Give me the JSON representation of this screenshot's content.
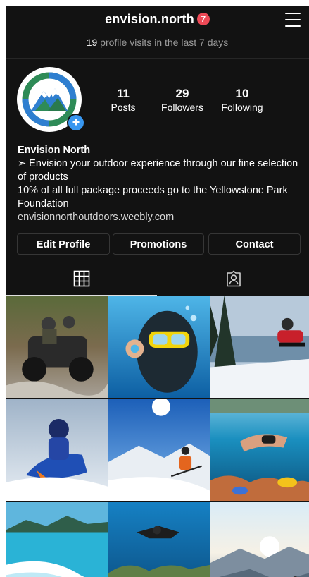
{
  "header": {
    "username": "envision.north",
    "notification_count": "7",
    "visits_count": "19",
    "visits_text": " profile visits in the last 7 days"
  },
  "profile": {
    "stats": {
      "posts": {
        "value": "11",
        "label": "Posts"
      },
      "followers": {
        "value": "29",
        "label": "Followers"
      },
      "following": {
        "value": "10",
        "label": "Following"
      }
    },
    "name": "Envision North",
    "bio_line1": "➣ Envision your outdoor experience through our fine selection of products",
    "bio_line2": "10% of all full package proceeds go to the Yellowstone Park Foundation",
    "website": "envisionnorthoutdoors.weebly.com",
    "add_story_glyph": "+"
  },
  "actions": {
    "edit_profile": "Edit Profile",
    "promotions": "Promotions",
    "contact": "Contact"
  },
  "tabs": [
    {
      "icon": "grid-icon",
      "active": true
    },
    {
      "icon": "tagged-person-icon",
      "active": false
    }
  ],
  "icons": {
    "menu": "hamburger-menu-icon",
    "logo": "mountain-logo-icon"
  },
  "colors": {
    "background": "#121212",
    "badge": "#ed4956",
    "add_badge": "#3897f0",
    "logo_green": "#2e8b57",
    "logo_blue": "#2f7fd0"
  },
  "posts": [
    {
      "subject": "atv-riders-photo"
    },
    {
      "subject": "scuba-diver-ok-sign-photo"
    },
    {
      "subject": "snowmobile-jump-forest-photo"
    },
    {
      "subject": "snowmobile-rider-photo"
    },
    {
      "subject": "skier-downhill-photo"
    },
    {
      "subject": "snorkeler-reef-photo"
    },
    {
      "subject": "boat-wake-lagoon-photo"
    },
    {
      "subject": "diver-coral-clownfish-photo"
    },
    {
      "subject": "mountain-sunrise-hiker-photo"
    }
  ]
}
